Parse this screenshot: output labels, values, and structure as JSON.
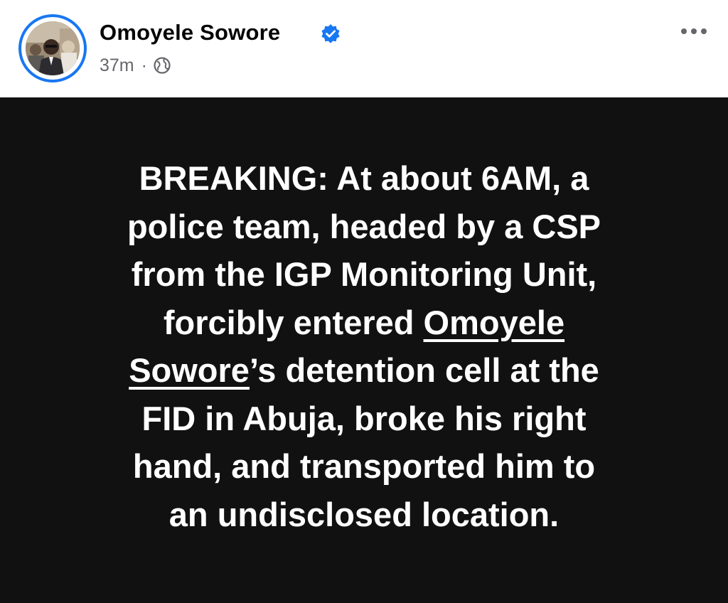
{
  "author": {
    "name": "Omoyele Sowore",
    "verified": true,
    "avatar_icon": "profile-photo"
  },
  "meta": {
    "time": "37m",
    "separator": "·",
    "audience_icon": "globe-icon"
  },
  "actions": {
    "more_icon": "more-horizontal-icon"
  },
  "post": {
    "background": "#111111",
    "text_color": "#ffffff",
    "lines": [
      "BREAKING: At about 6AM, a",
      "police team, headed by a CSP",
      "from the IGP Monitoring Unit,",
      "forcibly entered ",
      "Omoyele",
      "Sowore",
      "’s detention cell at the",
      "FID in Abuja, broke his right",
      "hand, and transported him to",
      "an undisclosed location."
    ]
  },
  "colors": {
    "accent": "#1877f2",
    "secondary_text": "#65676b"
  }
}
